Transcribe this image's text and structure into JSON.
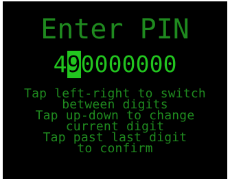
{
  "screen": {
    "title": "Enter PIN",
    "pin_digits": [
      "4",
      "9",
      "0",
      "0",
      "0",
      "0",
      "0",
      "0",
      "0"
    ],
    "selected_digit_index": 1,
    "instructions": [
      "Tap left-right to switch",
      "between digits",
      "Tap up-down to change",
      "current digit",
      "Tap past last digit",
      "to confirm"
    ]
  },
  "colors": {
    "background": "#000000",
    "text_dim_green": "#1f8a1f",
    "text_bright_green": "#22c51f",
    "highlight": "#22c51f"
  }
}
